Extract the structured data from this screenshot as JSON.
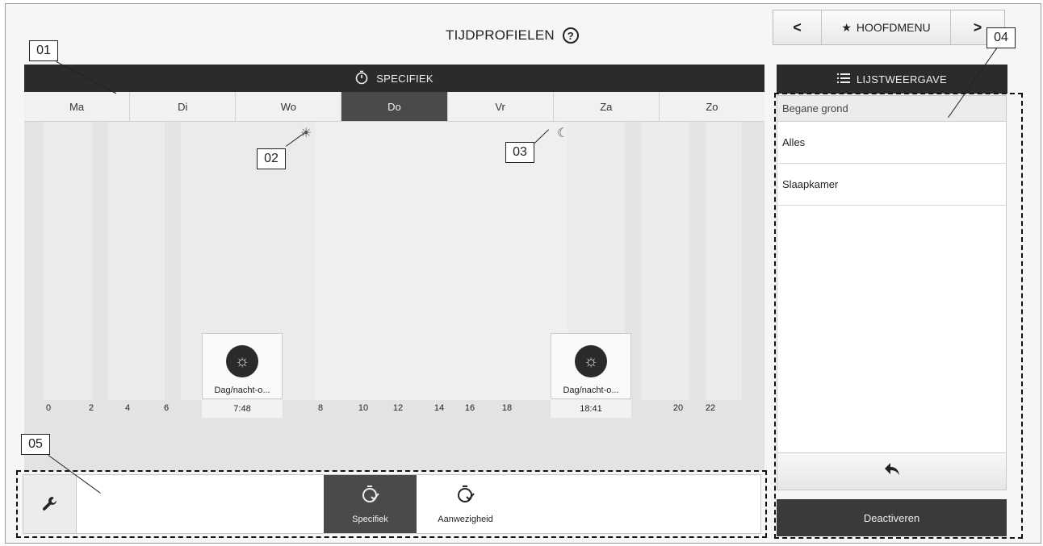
{
  "header": {
    "title": "TIJDPROFIELEN",
    "help_glyph": "?"
  },
  "nav": {
    "prev": "<",
    "home_label": "HOOFDMENU",
    "next": ">"
  },
  "schedule": {
    "header_label": "SPECIFIEK",
    "days": [
      {
        "label": "Ma",
        "active": false
      },
      {
        "label": "Di",
        "active": false
      },
      {
        "label": "Wo",
        "active": false
      },
      {
        "label": "Do",
        "active": true
      },
      {
        "label": "Vr",
        "active": false
      },
      {
        "label": "Za",
        "active": false
      },
      {
        "label": "Zo",
        "active": false
      }
    ],
    "events": [
      {
        "label": "Dag/nacht-o...",
        "time": "7:48",
        "icon": "sun-icon"
      },
      {
        "label": "Dag/nacht-o...",
        "time": "18:41",
        "icon": "sun-icon"
      }
    ],
    "ticks_left": [
      "0",
      "2",
      "4",
      "6"
    ],
    "ticks_mid": [
      "8",
      "10",
      "12",
      "14",
      "16",
      "18"
    ],
    "ticks_right": [
      "20",
      "22"
    ],
    "day_marker_icon": "sun-icon",
    "night_marker_icon": "moon-icon"
  },
  "toolbar": {
    "settings_icon": "wrench-icon",
    "buttons": [
      {
        "label": "Specifiek",
        "active": true,
        "icon": "timer-check-icon"
      },
      {
        "label": "Aanwezigheid",
        "active": false,
        "icon": "timer-check-icon"
      }
    ]
  },
  "list_panel": {
    "header_label": "LIJSTWEERGAVE",
    "group": "Begane grond",
    "items": [
      "Alles",
      "Slaapkamer"
    ],
    "back_icon": "back-arrow-icon",
    "deactivate_label": "Deactiveren"
  },
  "callouts": [
    "01",
    "02",
    "03",
    "04",
    "05"
  ]
}
